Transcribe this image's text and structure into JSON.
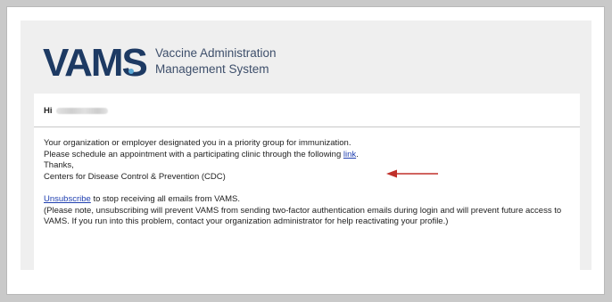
{
  "header": {
    "logo_text": "VAMS",
    "tagline_line1": "Vaccine Administration",
    "tagline_line2": "Management System"
  },
  "email": {
    "greeting": "Hi",
    "line1": "Your organization or employer designated you in a priority group for immunization.",
    "line2_prefix": "Please schedule an appointment with a participating clinic through the following ",
    "line2_link": "link",
    "line2_suffix": ".",
    "thanks": "Thanks,",
    "signature": "Centers for Disease Control & Prevention (CDC)",
    "unsubscribe_link": "Unsubscribe",
    "unsubscribe_text": " to stop receiving all emails from VAMS.",
    "note": "(Please note, unsubscribing will prevent VAMS from sending two-factor authentication emails during login and will prevent future access to VAMS. If you run into this problem, contact your organization administrator for help reactivating your profile.)"
  },
  "colors": {
    "logo": "#1d3a63",
    "logo_dot": "#5aa8d6",
    "link": "#1f3fb0",
    "annotation_arrow": "#c0302a"
  },
  "icons": {
    "annotation": "left-pointing-red-arrow"
  }
}
